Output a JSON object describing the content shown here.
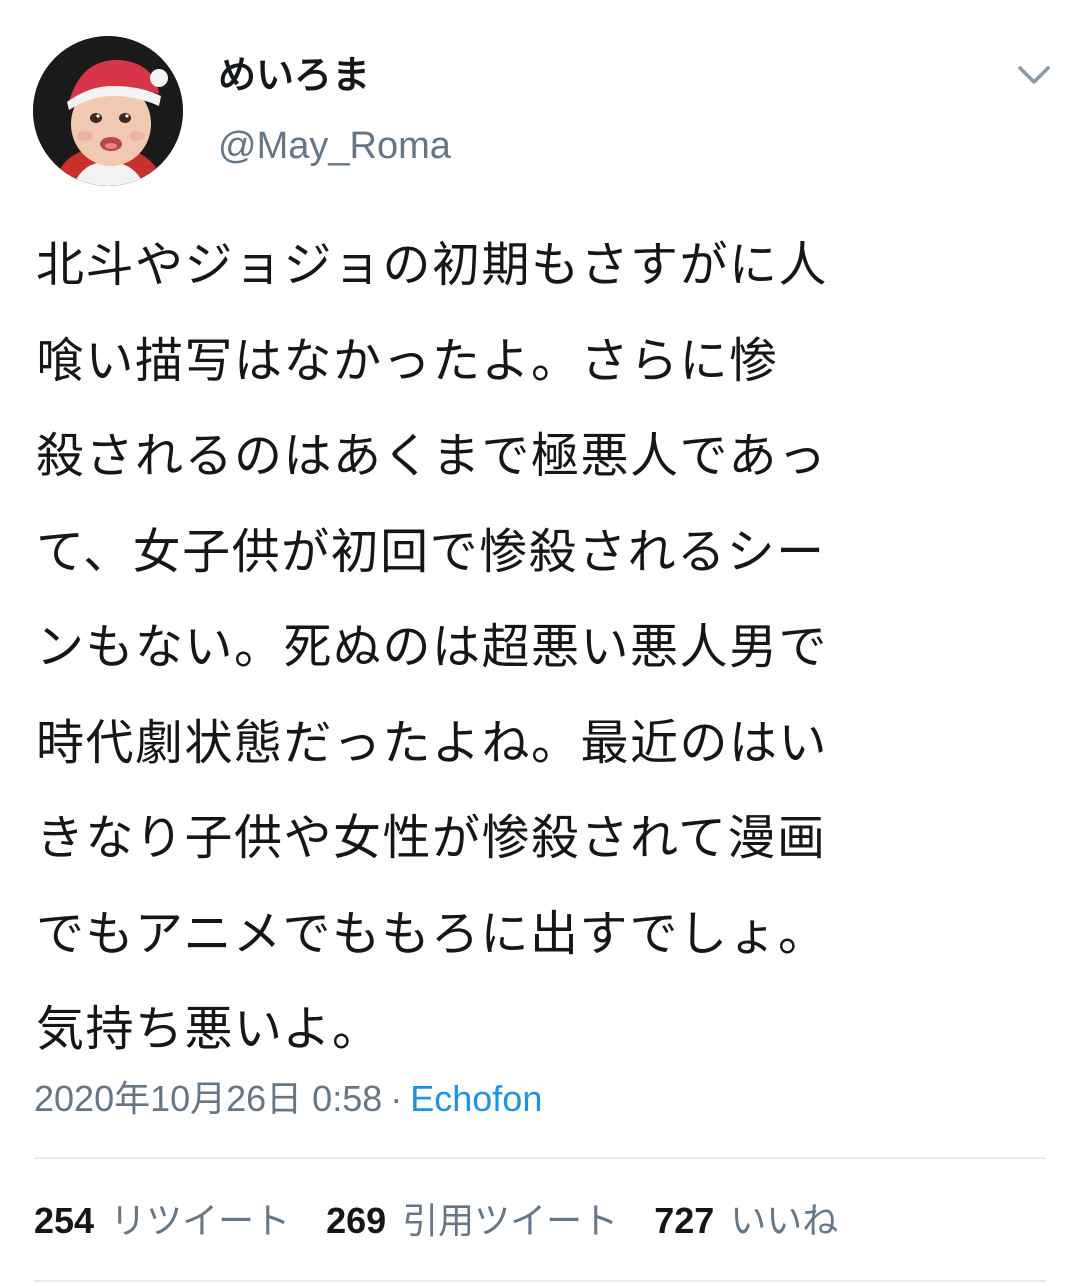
{
  "user": {
    "display_name": "めいろま",
    "handle": "@May_Roma",
    "avatar_icon": "avatar-photo"
  },
  "tweet": {
    "text": "北斗やジョジョの初期もさすがに人\n喰い描写はなかったよ。さらに惨\n殺されるのはあくまで極悪人であっ\nて、女子供が初回で惨殺されるシー\nンもない。死ぬのは超悪い悪人男で\n時代劇状態だったよね。最近のはい\nきなり子供や女性が惨殺されて漫画\nでもアニメでももろに出すでしょ。\n気持ち悪いよ。",
    "timestamp": "2020年10月26日 0:58",
    "separator": "·",
    "source": "Echofon"
  },
  "stats": [
    {
      "count": "254",
      "label": "リツイート"
    },
    {
      "count": "269",
      "label": "引用ツイート"
    },
    {
      "count": "727",
      "label": "いいね"
    }
  ],
  "menu_icon": "chevron-down-icon",
  "colors": {
    "text_primary": "#14171a",
    "text_secondary": "#657786",
    "link": "#1b95e0",
    "divider": "#e6ecf0",
    "background": "#ffffff"
  }
}
